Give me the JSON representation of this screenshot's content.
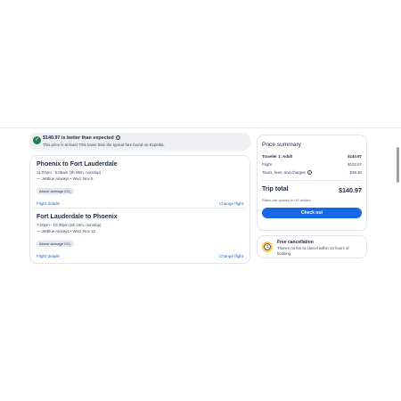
{
  "banner": {
    "title": "$140.97 is better than expected",
    "subtitle": "This price is at least 70% lower than the typical fare found on Expedia."
  },
  "flights": [
    {
      "route": "Phoenix to Fort Lauderdale",
      "times": "11:07pm - 5:06am (3h 59m, nonstop)",
      "airline": "JetBlue Airways • Wed, Nov 5",
      "badge": "Above average CO₂",
      "details_link": "Flight details",
      "change_link": "Change flight"
    },
    {
      "route": "Fort Lauderdale to Phoenix",
      "times": "7:20pm - 10:30pm (5h 10m, nonstop)",
      "airline": "JetBlue Airways • Wed, Nov 12",
      "badge": "Above average CO₂",
      "details_link": "Flight details",
      "change_link": "Change flight"
    }
  ],
  "summary": {
    "title": "Price summary",
    "traveler_label": "Traveler 1: Adult",
    "traveler_value": "$140.97",
    "flight_label": "Flight",
    "flight_value": "$102.67",
    "taxes_label": "Taxes, fees, and charges",
    "taxes_value": "$38.30",
    "total_label": "Trip total",
    "total_value": "$140.97",
    "currency_note": "Rates are quoted in US dollars",
    "checkout_label": "Check out"
  },
  "cancellation": {
    "title": "Free cancellation",
    "text": "There's no fee to cancel within 24 hours of booking."
  },
  "colors": {
    "accent": "#1668e3",
    "success": "#1e7f4e",
    "clock": "#ffc94d"
  }
}
